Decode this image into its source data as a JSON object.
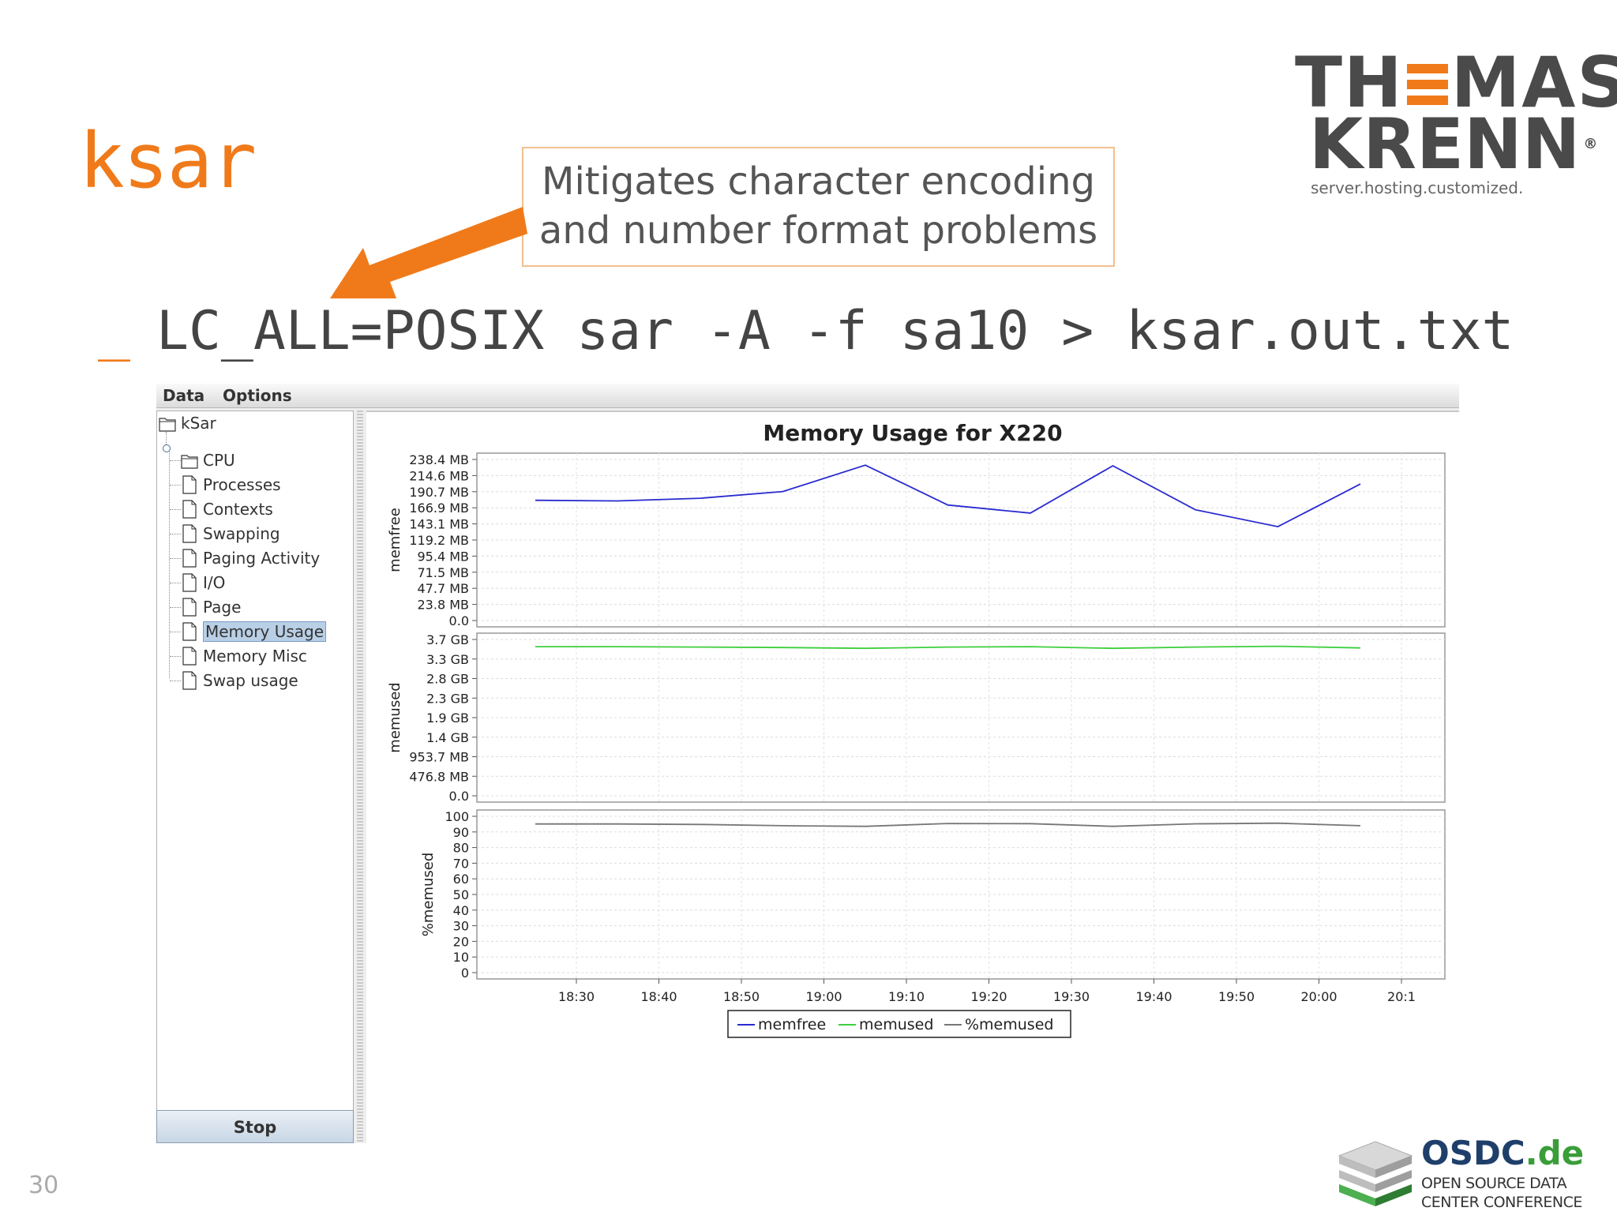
{
  "slide": {
    "title": "ksar",
    "callout": [
      "Mitigates character encoding",
      "and number format problems"
    ],
    "command_prompt": "_",
    "command": "LC_ALL=POSIX sar -A -f sa10 > ksar.out.txt",
    "page_number": "30"
  },
  "logo": {
    "line1_left": "TH",
    "line1_right": "MAS",
    "line2": "KRENN",
    "registered": "®",
    "tagline": "server.hosting.customized."
  },
  "conference": {
    "name_left": "OSDC",
    "name_right": ".de",
    "sub1": "OPEN SOURCE DATA",
    "sub2": "CENTER CONFERENCE"
  },
  "app": {
    "menu": [
      "Data",
      "Options"
    ],
    "tree": [
      {
        "label": "kSar",
        "icon": "folder-icon",
        "level": 0
      },
      {
        "label": "CPU",
        "icon": "folder-icon",
        "level": 1
      },
      {
        "label": "Processes",
        "icon": "document-icon",
        "level": 1
      },
      {
        "label": "Contexts",
        "icon": "document-icon",
        "level": 1
      },
      {
        "label": "Swapping",
        "icon": "document-icon",
        "level": 1
      },
      {
        "label": "Paging Activity",
        "icon": "document-icon",
        "level": 1
      },
      {
        "label": "I/O",
        "icon": "document-icon",
        "level": 1
      },
      {
        "label": "Page",
        "icon": "document-icon",
        "level": 1
      },
      {
        "label": "Memory Usage",
        "icon": "document-icon",
        "level": 1,
        "selected": true
      },
      {
        "label": "Memory Misc",
        "icon": "document-icon",
        "level": 1
      },
      {
        "label": "Swap usage",
        "icon": "document-icon",
        "level": 1
      }
    ],
    "stop_label": "Stop"
  },
  "chart_data": {
    "type": "line",
    "title": "Memory Usage for X220",
    "x": [
      "18:25",
      "18:35",
      "18:45",
      "18:55",
      "19:05",
      "19:15",
      "19:25",
      "19:35",
      "19:45",
      "19:55",
      "20:05"
    ],
    "x_ticks": [
      "18:30",
      "18:40",
      "18:50",
      "19:00",
      "19:10",
      "19:20",
      "19:30",
      "19:40",
      "19:50",
      "20:00",
      "20:1"
    ],
    "panels": [
      {
        "ylabel": "memfree",
        "y_ticks": [
          "238.4 MB",
          "214.6 MB",
          "190.7 MB",
          "166.9 MB",
          "143.1 MB",
          "119.2 MB",
          "95.4 MB",
          "71.5 MB",
          "47.7 MB",
          "23.8 MB",
          "0.0"
        ],
        "ylim": [
          0,
          238.4
        ],
        "unit": "MB",
        "series": [
          {
            "name": "memfree",
            "color": "#2a2acf",
            "values": [
              178,
              177,
              181,
              191,
              230,
              171,
              159,
              229,
              164,
              139,
              202
            ]
          }
        ]
      },
      {
        "ylabel": "memused",
        "y_ticks": [
          "3.7 GB",
          "3.3 GB",
          "2.8 GB",
          "2.3 GB",
          "1.9 GB",
          "1.4 GB",
          "953.7 MB",
          "476.8 MB",
          "0.0"
        ],
        "ylim": [
          0,
          3.7
        ],
        "unit": "GB",
        "series": [
          {
            "name": "memused",
            "color": "#3ccf3c",
            "values": [
              3.53,
              3.53,
              3.52,
              3.51,
              3.49,
              3.52,
              3.53,
              3.49,
              3.52,
              3.54,
              3.5
            ]
          }
        ]
      },
      {
        "ylabel": "%memused",
        "y_ticks": [
          "100",
          "90",
          "80",
          "70",
          "60",
          "50",
          "40",
          "30",
          "20",
          "10",
          "0"
        ],
        "ylim": [
          0,
          100
        ],
        "unit": "%",
        "series": [
          {
            "name": "%memused",
            "color": "#777777",
            "values": [
              95.1,
              95.1,
              94.8,
              94.0,
              93.6,
              95.4,
              95.3,
              93.6,
              95.2,
              95.6,
              94.0
            ]
          }
        ]
      }
    ],
    "legend": [
      "memfree",
      "memused",
      "%memused"
    ],
    "legend_position": "bottom",
    "grid": true
  }
}
